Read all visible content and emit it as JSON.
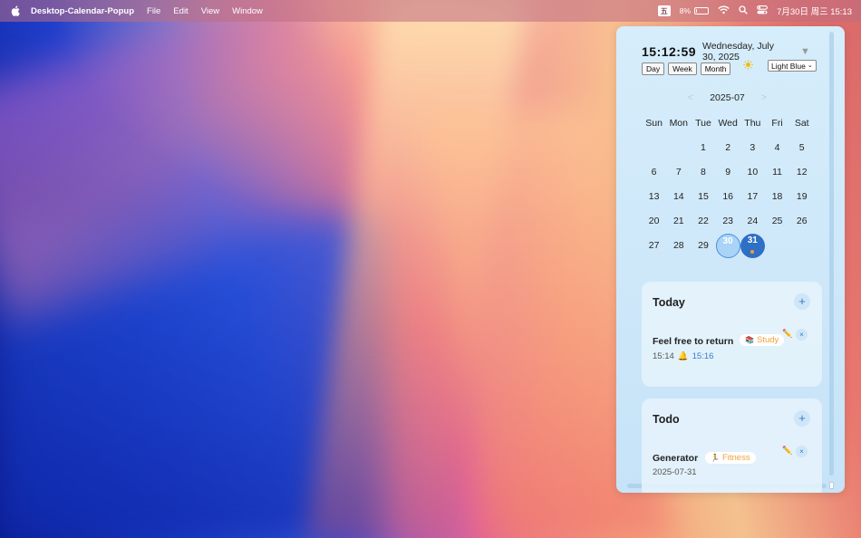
{
  "menubar": {
    "app_name": "Desktop-Calendar-Popup",
    "menus": [
      "File",
      "Edit",
      "View",
      "Window"
    ],
    "ime_label": "五",
    "battery_percent": "8%",
    "battery_level": 0.08,
    "datetime": "7月30日 周三 15:13"
  },
  "panel": {
    "clock": "15:12:59",
    "date": "Wednesday, July 30, 2025",
    "view_buttons": [
      "Day",
      "Week",
      "Month"
    ],
    "theme": "Light Blue",
    "month_label": "2025-07",
    "prev_label": "<",
    "next_label": ">",
    "collapse_label": "▼",
    "weekdays": [
      "Sun",
      "Mon",
      "Tue",
      "Wed",
      "Thu",
      "Fri",
      "Sat"
    ],
    "weeks": [
      [
        "",
        "",
        "1",
        "2",
        "3",
        "4",
        "5"
      ],
      [
        "6",
        "7",
        "8",
        "9",
        "10",
        "11",
        "12"
      ],
      [
        "13",
        "14",
        "15",
        "16",
        "17",
        "18",
        "19"
      ],
      [
        "20",
        "21",
        "22",
        "23",
        "24",
        "25",
        "26"
      ],
      [
        "27",
        "28",
        "29",
        "30",
        "31",
        "",
        ""
      ]
    ],
    "today_day": "30",
    "selected_day": "31"
  },
  "today_section": {
    "title": "Today",
    "add_label": "+",
    "item": {
      "title": "Feel free to return",
      "tag": "Study",
      "time": "15:14",
      "reminder": "15:16"
    }
  },
  "todo_section": {
    "title": "Todo",
    "add_label": "+",
    "item": {
      "title": "Generator",
      "tag": "Fitness",
      "date": "2025-07-31"
    }
  },
  "delete_label": "×"
}
